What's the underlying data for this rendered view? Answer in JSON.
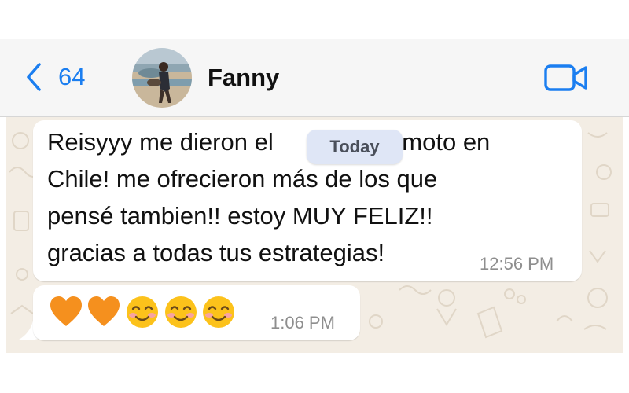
{
  "header": {
    "back_count": "64",
    "contact_name": "Fanny",
    "accent_color": "#1b7ef0",
    "icons": [
      "chevron-left-icon",
      "video-call-icon"
    ]
  },
  "messages": [
    {
      "text": "Reisyyy me dieron el trabajo remoto en Chile! me ofrecieron más de los que pensé tambien!! estoy MUY FELIZ!! gracias a todas tus estrategias!",
      "visible_lines": [
        "Reisyyy me dieron el",
        "remoto en",
        "Chile! me ofrecieron más de los que",
        "pensé tambien!! estoy MUY FELIZ!!",
        "gracias a todas tus estrategias!"
      ],
      "time": "12:56 PM"
    },
    {
      "emojis": [
        "orange-heart",
        "orange-heart",
        "smiling-face",
        "smiling-face",
        "smiling-face"
      ],
      "time": "1:06 PM"
    }
  ],
  "date_divider": "Today",
  "colors": {
    "wallpaper": "#f3ede4",
    "bubble": "#ffffff",
    "heart": "#f5901e",
    "today_pill": "#dfe6f6"
  }
}
